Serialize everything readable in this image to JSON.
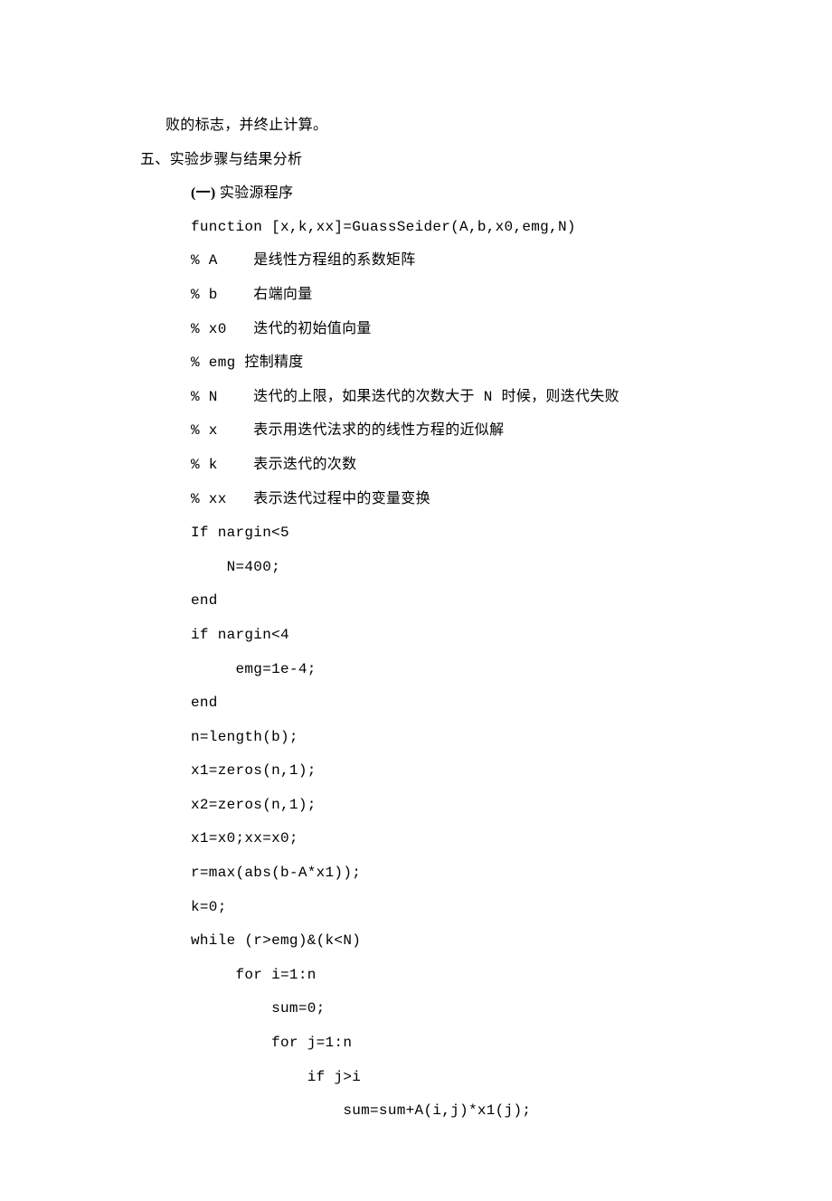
{
  "lines": [
    {
      "cls": "line indent-1",
      "text": "败的标志，并终止计算。"
    },
    {
      "cls": "line",
      "text": "五、实验步骤与结果分析"
    },
    {
      "cls": "line indent-2 heading-row",
      "text": "",
      "parts": [
        {
          "cls": "sub-heading-num",
          "text": "(一) "
        },
        {
          "cls": "",
          "text": "实验源程序"
        }
      ]
    },
    {
      "cls": "line indent-2 mono",
      "text": "function [x,k,xx]=GuassSeider(A,b,x0,emg,N)"
    },
    {
      "cls": "line indent-2 mono",
      "text": "% A    是线性方程组的系数矩阵"
    },
    {
      "cls": "line indent-2 mono",
      "text": "% b    右端向量"
    },
    {
      "cls": "line indent-2 mono",
      "text": "% x0   迭代的初始值向量"
    },
    {
      "cls": "line indent-2 mono",
      "text": "% emg 控制精度"
    },
    {
      "cls": "line indent-2 mono",
      "text": "% N    迭代的上限，如果迭代的次数大于 N 时候，则迭代失败"
    },
    {
      "cls": "line indent-2 mono",
      "text": "% x    表示用迭代法求的的线性方程的近似解"
    },
    {
      "cls": "line indent-2 mono",
      "text": "% k    表示迭代的次数"
    },
    {
      "cls": "line indent-2 mono",
      "text": "% xx   表示迭代过程中的变量变换"
    },
    {
      "cls": "line indent-2 mono",
      "text": "If nargin<5"
    },
    {
      "cls": "line indent-2 mono",
      "text": "    N=400;"
    },
    {
      "cls": "line indent-2 mono",
      "text": "end"
    },
    {
      "cls": "line indent-2 mono",
      "text": "if nargin<4"
    },
    {
      "cls": "line indent-2 mono",
      "text": "     emg=1e-4;"
    },
    {
      "cls": "line indent-2 mono",
      "text": "end"
    },
    {
      "cls": "line indent-2 mono",
      "text": "n=length(b);"
    },
    {
      "cls": "line indent-2 mono",
      "text": "x1=zeros(n,1);"
    },
    {
      "cls": "line indent-2 mono",
      "text": "x2=zeros(n,1);"
    },
    {
      "cls": "line indent-2 mono",
      "text": "x1=x0;xx=x0;"
    },
    {
      "cls": "line indent-2 mono",
      "text": "r=max(abs(b-A*x1));"
    },
    {
      "cls": "line indent-2 mono",
      "text": "k=0;"
    },
    {
      "cls": "line indent-2 mono",
      "text": "while (r>emg)&(k<N)"
    },
    {
      "cls": "line indent-2 mono",
      "text": "     for i=1:n"
    },
    {
      "cls": "line indent-2 mono",
      "text": "         sum=0;"
    },
    {
      "cls": "line indent-2 mono",
      "text": "         for j=1:n"
    },
    {
      "cls": "line indent-2 mono",
      "text": "             if j>i"
    },
    {
      "cls": "line indent-2 mono",
      "text": "                 sum=sum+A(i,j)*x1(j);"
    }
  ]
}
